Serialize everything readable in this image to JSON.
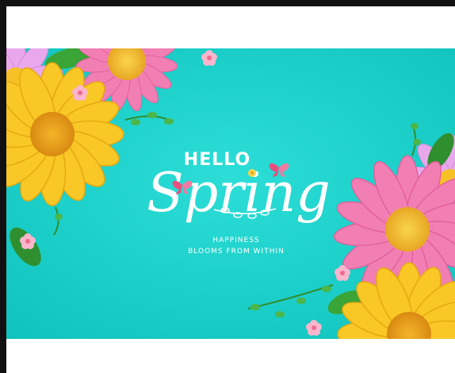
{
  "banner": {
    "hello": "HELLO",
    "title": "Spring",
    "tagline_line1": "HAPPINESS",
    "tagline_line2": "BLOOMS FROM WITHIN"
  },
  "colors": {
    "background": "#17cfc9",
    "frame": "#111111",
    "pink_flower": "#f27fb3",
    "yellow_flower": "#f6c31c",
    "lilac_flower": "#e8a6ea",
    "leaf": "#3aa536",
    "butterfly": "#e8517f"
  }
}
